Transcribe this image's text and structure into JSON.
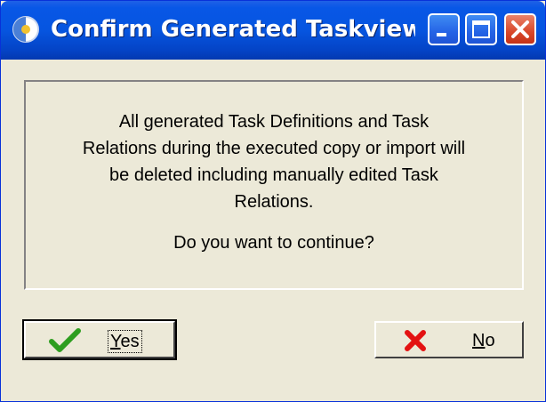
{
  "window": {
    "title": "Confirm Generated Taskview P..."
  },
  "message": {
    "body": "All generated Task Definitions and Task\nRelations during the executed copy or import will\nbe deleted including manually edited Task\nRelations.",
    "question": "Do you want to continue?"
  },
  "buttons": {
    "yes": {
      "mnemonic": "Y",
      "rest": "es",
      "icon": "check-icon"
    },
    "no": {
      "mnemonic": "N",
      "rest": "o",
      "icon": "x-icon"
    }
  },
  "colors": {
    "titlebar": "#0655e0",
    "window_bg": "#ece9d8",
    "close_button": "#d9482a",
    "check_green": "#2e9e1f",
    "x_red": "#e31212"
  }
}
